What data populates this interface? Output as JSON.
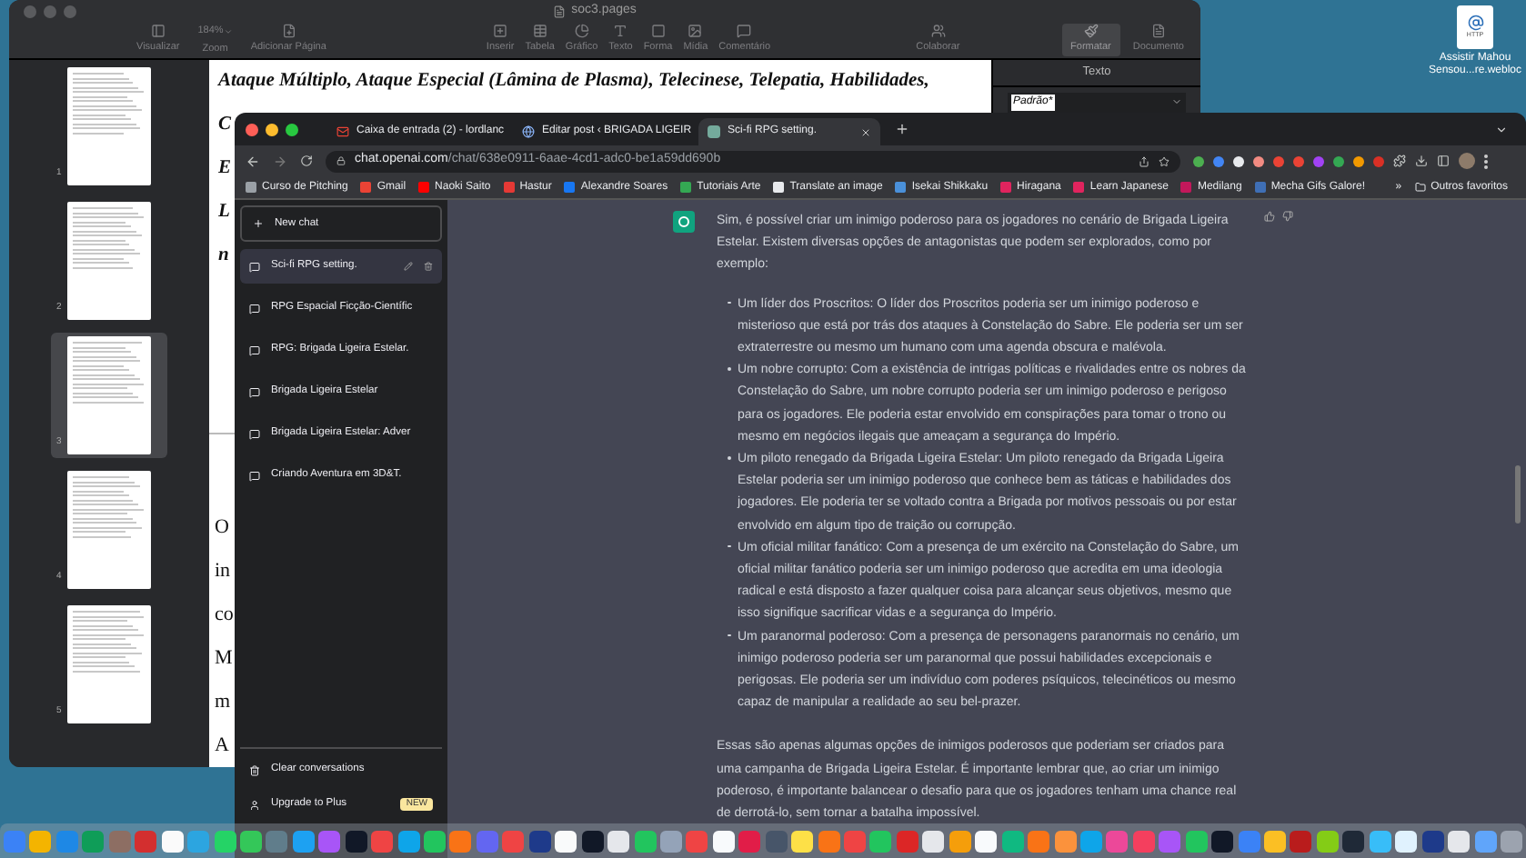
{
  "pages_window": {
    "title": "soc3.pages",
    "toolbar_left": [
      {
        "label": "Visualizar"
      },
      {
        "label": "Zoom",
        "value": "184%"
      },
      {
        "label": "Adicionar Página"
      }
    ],
    "toolbar_middle": [
      {
        "label": "Inserir"
      },
      {
        "label": "Tabela"
      },
      {
        "label": "Gráfico"
      },
      {
        "label": "Texto"
      },
      {
        "label": "Forma"
      },
      {
        "label": "Mídia"
      },
      {
        "label": "Comentário"
      }
    ],
    "collaborate": "Colaborar",
    "inspector_tabs": [
      {
        "label": "Formatar",
        "selected": true
      },
      {
        "label": "Documento",
        "selected": false
      }
    ],
    "thumbnails": [
      {
        "number": "1",
        "selected": false
      },
      {
        "number": "2",
        "selected": false
      },
      {
        "number": "3",
        "selected": true
      },
      {
        "number": "4",
        "selected": false
      },
      {
        "number": "5",
        "selected": false
      }
    ],
    "document_upper": [
      "Ataque Múltiplo, Ataque Especial (Lâmina de Plasma), Telecinese, Telepatia, Habilidades,",
      "C",
      "E",
      "L",
      "n"
    ],
    "document_lower": [
      "O",
      "in",
      "co",
      "M",
      "m",
      "A"
    ],
    "inspector_header": "Texto",
    "paragraph_style": "Padrão*"
  },
  "desktop_icon": {
    "badge": "HTTP",
    "label": "Assistir Mahou Sensou...re.webloc"
  },
  "browser": {
    "tabs": [
      {
        "title": "Caixa de entrada (2) - lordlanc",
        "kind": "mail",
        "selected": false
      },
      {
        "title": "Editar post ‹ BRIGADA LIGEIR",
        "kind": "wordpress",
        "selected": false
      },
      {
        "title": "Sci-fi RPG setting.",
        "kind": "chat",
        "selected": true
      }
    ],
    "url_host": "chat.openai.com",
    "url_path": "/chat/638e0911-6aae-4cd1-adc0-be1a59dd690b",
    "bookmarks": [
      {
        "label": "Curso de Pitching",
        "color": "#9aa0a6"
      },
      {
        "label": "Gmail",
        "color": "#ea4335"
      },
      {
        "label": "Naoki Saito",
        "color": "#ff0000"
      },
      {
        "label": "Hastur",
        "color": "#e53935"
      },
      {
        "label": "Alexandre Soares",
        "color": "#1877f2"
      },
      {
        "label": "Tutoriais Arte",
        "color": "#34a853"
      },
      {
        "label": "Translate an image",
        "color": "#e8eaed"
      },
      {
        "label": "Isekai Shikkaku",
        "color": "#4a90d9"
      },
      {
        "label": "Hiragana",
        "color": "#e0245e"
      },
      {
        "label": "Learn Japanese",
        "color": "#e0245e"
      },
      {
        "label": "Medilang",
        "color": "#c2185b"
      },
      {
        "label": "Mecha Gifs Galore!",
        "color": "#3f6fb5"
      }
    ],
    "more": "»",
    "other_bookmarks": "Outros favoritos"
  },
  "chat": {
    "new_chat": "New chat",
    "conversations": [
      {
        "title": "Sci-fi RPG setting.",
        "selected": true
      },
      {
        "title": "RPG Espacial Ficção-Científic",
        "selected": false
      },
      {
        "title": "RPG: Brigada Ligeira Estelar.",
        "selected": false
      },
      {
        "title": "Brigada Ligeira Estelar",
        "selected": false
      },
      {
        "title": "Brigada Ligeira Estelar: Adver",
        "selected": false
      },
      {
        "title": "Criando Aventura em 3D&T.",
        "selected": false
      }
    ],
    "clear": "Clear conversations",
    "upgrade": "Upgrade to Plus",
    "upgrade_badge": "NEW",
    "message": {
      "intro": "Sim, é possível criar um inimigo poderoso para os jogadores no cenário de Brigada Ligeira Estelar. Existem diversas opções de antagonistas que podem ser explorados, como por exemplo:",
      "items": [
        "Um líder dos Proscritos: O líder dos Proscritos poderia ser um inimigo poderoso e misterioso que está por trás dos ataques à Constelação do Sabre. Ele poderia ser um ser extraterrestre ou mesmo um humano com uma agenda obscura e malévola.",
        "Um nobre corrupto: Com a existência de intrigas políticas e rivalidades entre os nobres da Constelação do Sabre, um nobre corrupto poderia ser um inimigo poderoso e perigoso para os jogadores. Ele poderia estar envolvido em conspirações para tomar o trono ou mesmo em negócios ilegais que ameaçam a segurança do Império.",
        "Um piloto renegado da Brigada Ligeira Estelar: Um piloto renegado da Brigada Ligeira Estelar poderia ser um inimigo poderoso que conhece bem as táticas e habilidades dos jogadores. Ele poderia ter se voltado contra a Brigada por motivos pessoais ou por estar envolvido em algum tipo de traição ou corrupção.",
        "Um oficial militar fanático: Com a presença de um exército na Constelação do Sabre, um oficial militar fanático poderia ser um inimigo poderoso que acredita em uma ideologia radical e está disposto a fazer qualquer coisa para alcançar seus objetivos, mesmo que isso signifique sacrificar vidas e a segurança do Império.",
        "Um paranormal poderoso: Com a presença de personagens paranormais no cenário, um inimigo poderoso poderia ser um paranormal que possui habilidades excepcionais e perigosas. Ele poderia ser um indivíduo com poderes psíquicos, telecinéticos ou mesmo capaz de manipular a realidade ao seu bel-prazer."
      ],
      "outro": "Essas são apenas algumas opções de inimigos poderosos que poderiam ser criados para uma campanha de Brigada Ligeira Estelar. É importante lembrar que, ao criar um inimigo poderoso, é importante balancear o desafio para que os jogadores tenham uma chance real de derrotá-lo, sem tornar a batalha impossível."
    }
  }
}
